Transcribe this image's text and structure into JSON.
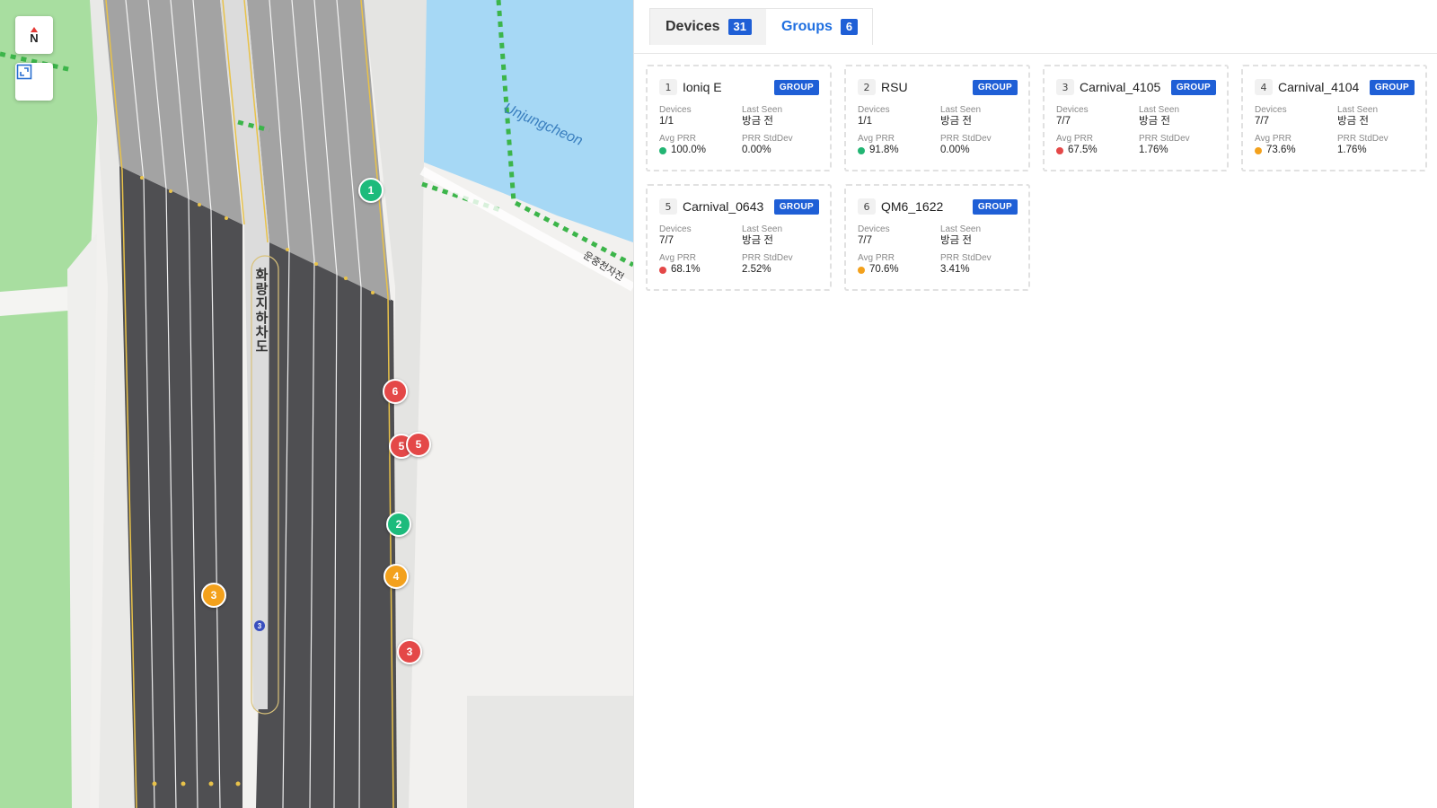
{
  "map": {
    "compass_label": "N",
    "road_label": "화랑지하차도",
    "water_label": "Unjungcheon",
    "path_label": "운중천자전",
    "markers": [
      {
        "label": "1",
        "color": "#1dbb7c"
      },
      {
        "label": "6",
        "color": "#e44848"
      },
      {
        "label": "5",
        "color": "#e44848"
      },
      {
        "label": "5",
        "color": "#e44848"
      },
      {
        "label": "2",
        "color": "#1dbb7c"
      },
      {
        "label": "4",
        "color": "#f3a11c"
      },
      {
        "label": "3",
        "color": "#f3a11c"
      },
      {
        "label": "3",
        "color": "#e44848"
      },
      {
        "label": "3",
        "color": "#3a4fbf"
      }
    ]
  },
  "tabs": [
    {
      "label": "Devices",
      "count": "31",
      "active": false
    },
    {
      "label": "Groups",
      "count": "6",
      "active": true
    }
  ],
  "cards": [
    {
      "idx": "1",
      "name": "Ioniq E",
      "badge": "GROUP",
      "devices_label": "Devices",
      "devices": "1/1",
      "last_seen_label": "Last Seen",
      "last_seen": "방금 전",
      "avg_prr_label": "Avg PRR",
      "avg_prr": "100.0%",
      "status_color": "#22b573",
      "stddev_label": "PRR StdDev",
      "stddev": "0.00%"
    },
    {
      "idx": "2",
      "name": "RSU",
      "badge": "GROUP",
      "devices_label": "Devices",
      "devices": "1/1",
      "last_seen_label": "Last Seen",
      "last_seen": "방금 전",
      "avg_prr_label": "Avg PRR",
      "avg_prr": "91.8%",
      "status_color": "#22b573",
      "stddev_label": "PRR StdDev",
      "stddev": "0.00%"
    },
    {
      "idx": "3",
      "name": "Carnival_4105",
      "badge": "GROUP",
      "devices_label": "Devices",
      "devices": "7/7",
      "last_seen_label": "Last Seen",
      "last_seen": "방금 전",
      "avg_prr_label": "Avg PRR",
      "avg_prr": "67.5%",
      "status_color": "#e44848",
      "stddev_label": "PRR StdDev",
      "stddev": "1.76%"
    },
    {
      "idx": "4",
      "name": "Carnival_4104",
      "badge": "GROUP",
      "devices_label": "Devices",
      "devices": "7/7",
      "last_seen_label": "Last Seen",
      "last_seen": "방금 전",
      "avg_prr_label": "Avg PRR",
      "avg_prr": "73.6%",
      "status_color": "#f3a11c",
      "stddev_label": "PRR StdDev",
      "stddev": "1.76%"
    },
    {
      "idx": "5",
      "name": "Carnival_0643",
      "badge": "GROUP",
      "devices_label": "Devices",
      "devices": "7/7",
      "last_seen_label": "Last Seen",
      "last_seen": "방금 전",
      "avg_prr_label": "Avg PRR",
      "avg_prr": "68.1%",
      "status_color": "#e44848",
      "stddev_label": "PRR StdDev",
      "stddev": "2.52%"
    },
    {
      "idx": "6",
      "name": "QM6_1622",
      "badge": "GROUP",
      "devices_label": "Devices",
      "devices": "7/7",
      "last_seen_label": "Last Seen",
      "last_seen": "방금 전",
      "avg_prr_label": "Avg PRR",
      "avg_prr": "70.6%",
      "status_color": "#f3a11c",
      "stddev_label": "PRR StdDev",
      "stddev": "3.41%"
    }
  ]
}
